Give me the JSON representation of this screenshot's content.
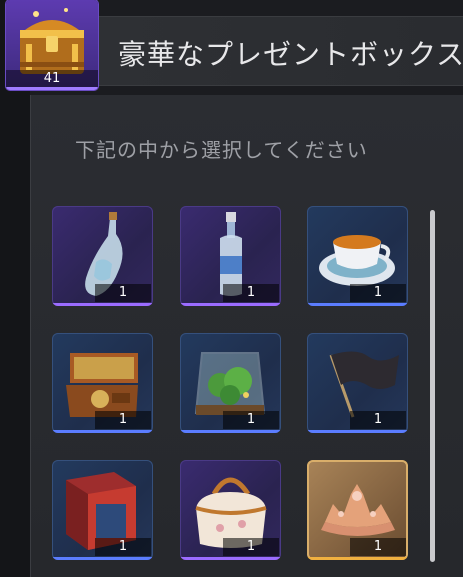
{
  "header": {
    "title": "豪華なプレゼントボックス",
    "chest_count": "41",
    "chest_icon": "treasure-chest-icon"
  },
  "prompt": "下記の中から選択してください",
  "items": [
    {
      "name": "message-bottle",
      "icon": "bottle-icon",
      "count": "1",
      "rarity": "epic"
    },
    {
      "name": "blue-liquor-bottle",
      "icon": "liquor-bottle-icon",
      "count": "1",
      "rarity": "epic"
    },
    {
      "name": "tea-cup",
      "icon": "teacup-icon",
      "count": "1",
      "rarity": "rare"
    },
    {
      "name": "music-box",
      "icon": "music-box-icon",
      "count": "1",
      "rarity": "rare"
    },
    {
      "name": "terrarium",
      "icon": "terrarium-icon",
      "count": "1",
      "rarity": "rare"
    },
    {
      "name": "black-flag",
      "icon": "flag-icon",
      "count": "1",
      "rarity": "rare"
    },
    {
      "name": "book-box",
      "icon": "box-icon",
      "count": "1",
      "rarity": "rare"
    },
    {
      "name": "handbag",
      "icon": "handbag-icon",
      "count": "1",
      "rarity": "epic"
    },
    {
      "name": "tiara",
      "icon": "tiara-icon",
      "count": "1",
      "rarity": "legend"
    }
  ],
  "colors": {
    "epic": "#9b6cff",
    "rare": "#5b7dff",
    "legend": "#f0b040",
    "background": "#1b1c20",
    "panel": "#2b2d32"
  }
}
